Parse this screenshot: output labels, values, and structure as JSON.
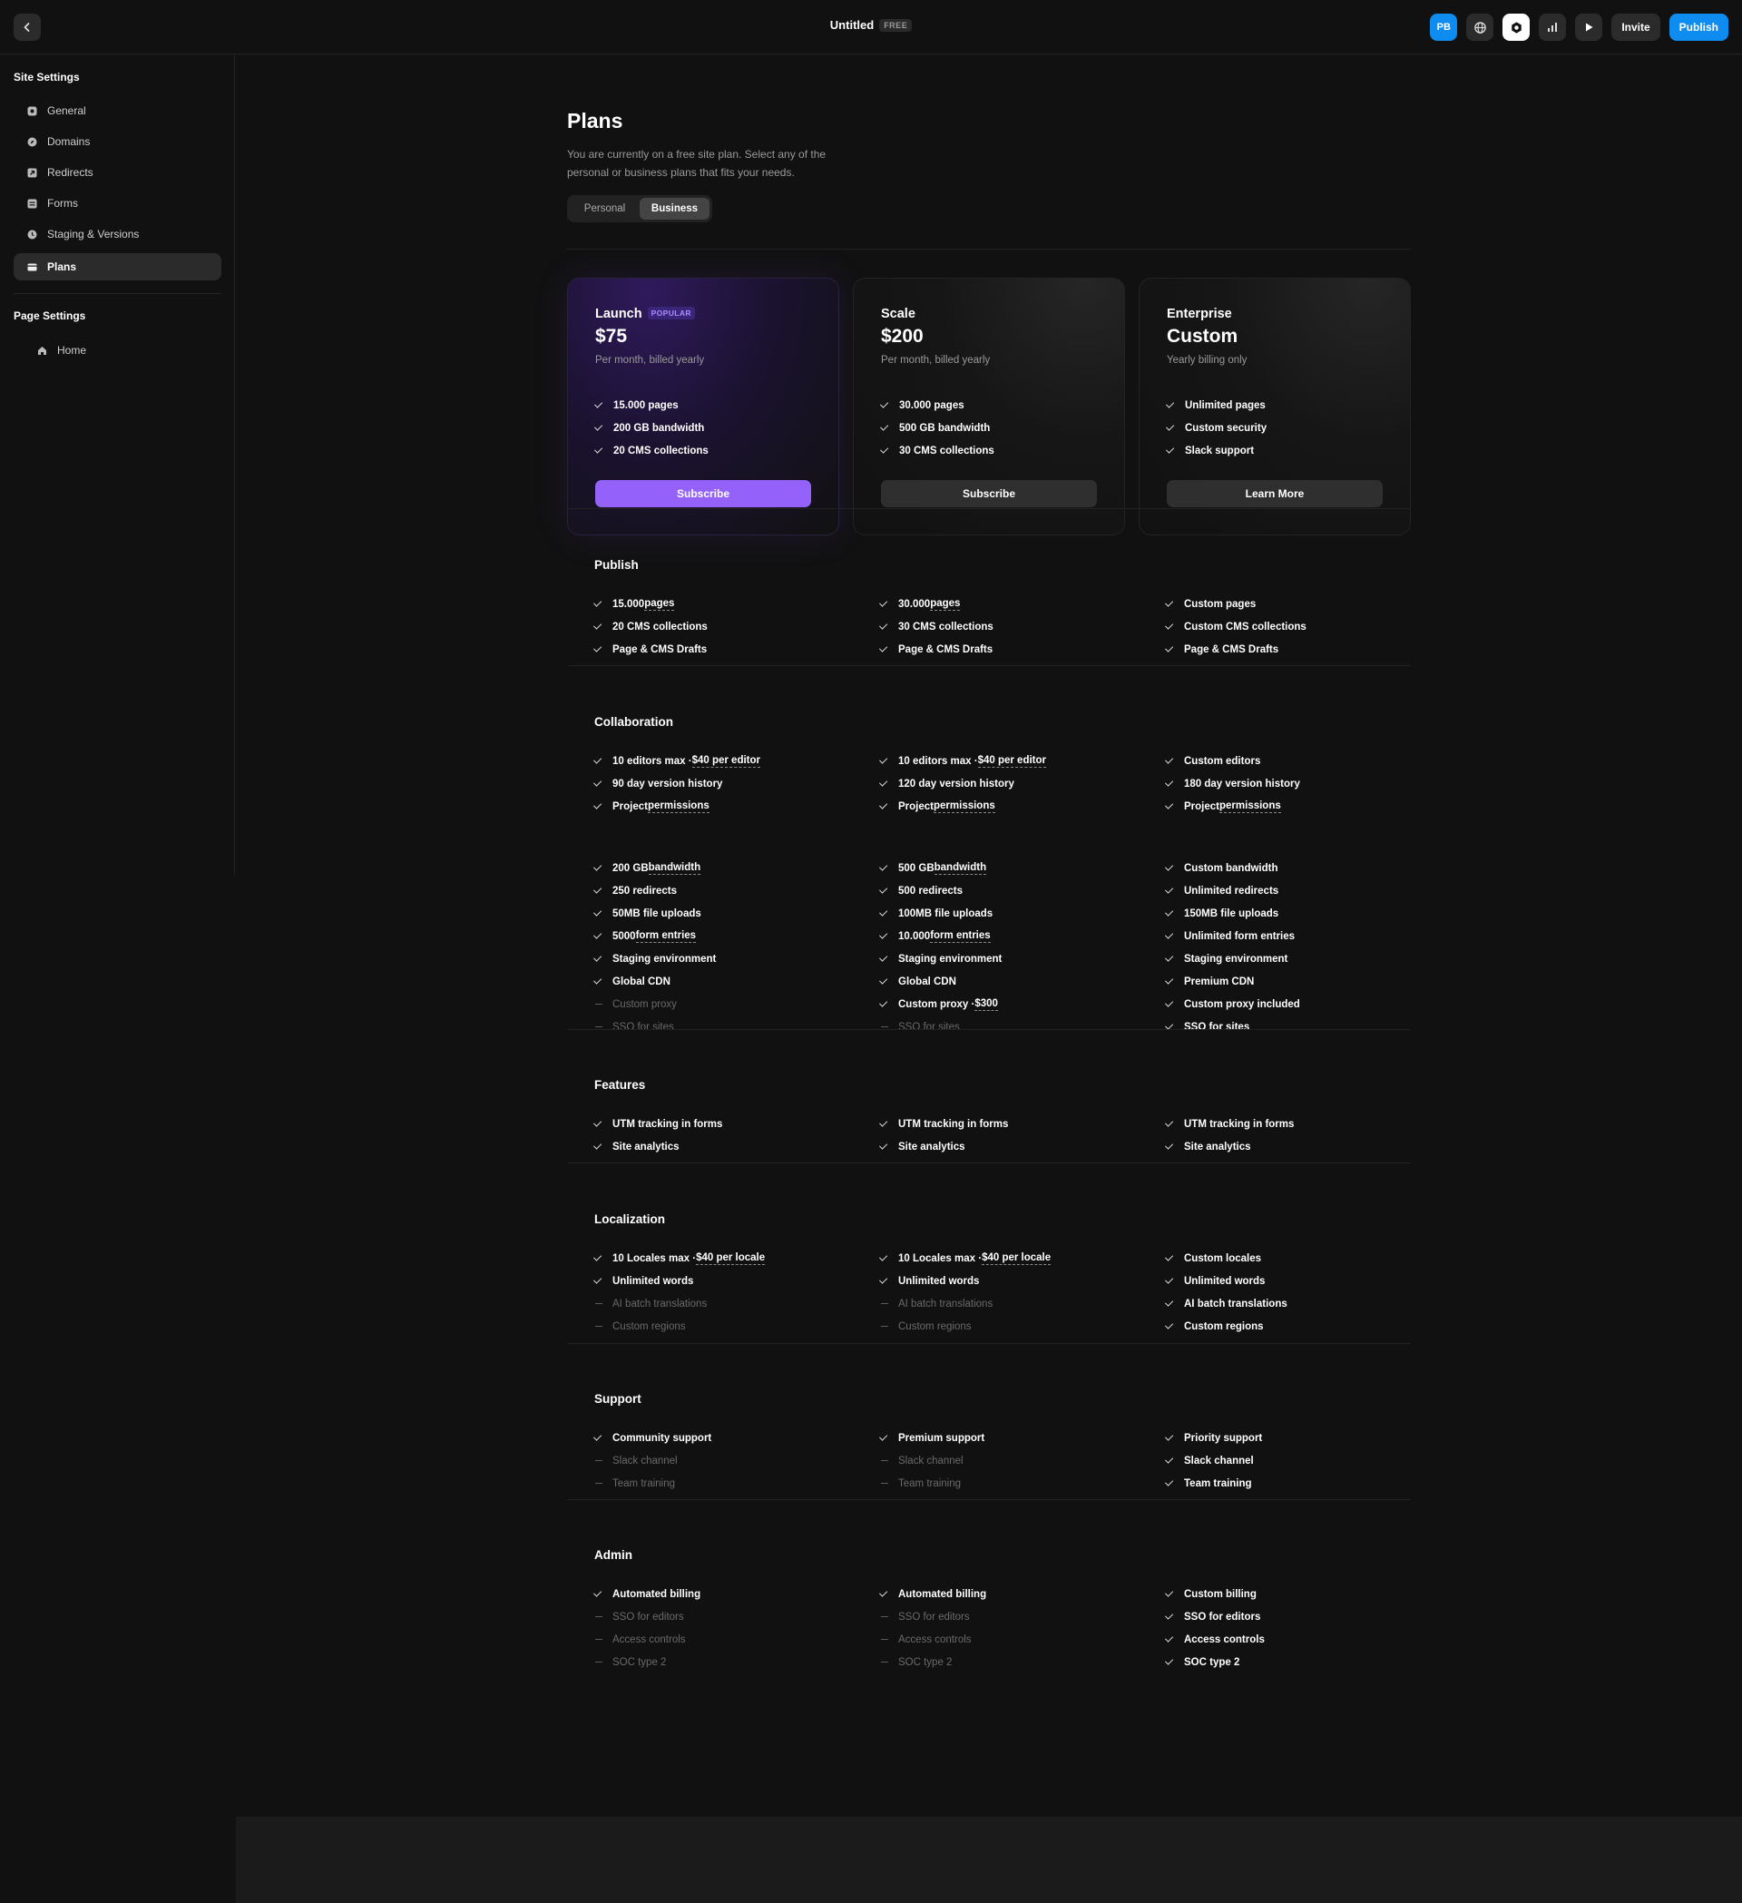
{
  "topbar": {
    "title": "Untitled",
    "badge": "FREE",
    "avatar": "PB",
    "invite": "Invite",
    "publish": "Publish"
  },
  "sidebar": {
    "site_heading": "Site Settings",
    "site_items": [
      "General",
      "Domains",
      "Redirects",
      "Forms",
      "Staging & Versions",
      "Plans"
    ],
    "page_heading": "Page Settings",
    "page_items": [
      "Home"
    ]
  },
  "plans": {
    "title": "Plans",
    "description": "You are currently on a free site plan. Select any of the personal or business plans that fits your needs.",
    "toggle": [
      "Personal",
      "Business"
    ],
    "cards": [
      {
        "name": "Launch",
        "badge": "POPULAR",
        "price": "$75",
        "billing": "Per month, billed yearly",
        "features": [
          "15.000 pages",
          "200 GB bandwidth",
          "20 CMS collections"
        ],
        "cta": "Subscribe"
      },
      {
        "name": "Scale",
        "price": "$200",
        "billing": "Per month, billed yearly",
        "features": [
          "30.000 pages",
          "500 GB bandwidth",
          "30 CMS collections"
        ],
        "cta": "Subscribe"
      },
      {
        "name": "Enterprise",
        "price": "Custom",
        "billing": "Yearly billing only",
        "features": [
          "Unlimited pages",
          "Custom security",
          "Slack support"
        ],
        "cta": "Learn More"
      }
    ]
  },
  "sections": [
    {
      "title": "Publish",
      "columns": [
        [
          {
            "t": "15.000 ",
            "u": "pages",
            "on": true
          },
          {
            "t": "20 CMS collections",
            "on": true
          },
          {
            "t": "Page & CMS Drafts",
            "on": true
          }
        ],
        [
          {
            "t": "30.000 ",
            "u": "pages",
            "on": true
          },
          {
            "t": "30 CMS collections",
            "on": true
          },
          {
            "t": "Page & CMS Drafts",
            "on": true
          }
        ],
        [
          {
            "t": "Custom pages",
            "on": true
          },
          {
            "t": "Custom CMS collections",
            "on": true
          },
          {
            "t": "Page & CMS Drafts",
            "on": true
          }
        ]
      ]
    },
    {
      "title": "Collaboration",
      "columns": [
        [
          {
            "t": "10 editors max · ",
            "u": "$40 per editor",
            "on": true
          },
          {
            "t": "90 day version history",
            "on": true
          },
          {
            "t": "Project ",
            "u": "permissions",
            "on": true
          }
        ],
        [
          {
            "t": "10 editors max · ",
            "u": "$40 per editor",
            "on": true
          },
          {
            "t": "120 day version history",
            "on": true
          },
          {
            "t": "Project ",
            "u": "permissions",
            "on": true
          }
        ],
        [
          {
            "t": "Custom editors",
            "on": true
          },
          {
            "t": "180 day version history",
            "on": true
          },
          {
            "t": "Project ",
            "u": "permissions",
            "on": true
          }
        ]
      ]
    },
    {
      "title": "",
      "columns": [
        [
          {
            "t": "200 GB ",
            "u": "bandwidth",
            "on": true
          },
          {
            "t": "250 redirects",
            "on": true
          },
          {
            "t": "50MB file uploads",
            "on": true
          },
          {
            "t": "5000 ",
            "u": "form entries",
            "on": true
          },
          {
            "t": "Staging environment",
            "on": true
          },
          {
            "t": "Global CDN",
            "on": true
          },
          {
            "t": "Custom proxy",
            "on": false
          },
          {
            "t": "SSO for sites",
            "on": false
          }
        ],
        [
          {
            "t": "500 GB ",
            "u": "bandwidth",
            "on": true
          },
          {
            "t": "500 redirects",
            "on": true
          },
          {
            "t": "100MB file uploads",
            "on": true
          },
          {
            "t": "10.000 ",
            "u": "form entries",
            "on": true
          },
          {
            "t": "Staging environment",
            "on": true
          },
          {
            "t": "Global CDN",
            "on": true
          },
          {
            "t": "Custom proxy · ",
            "u": "$300",
            "on": true
          },
          {
            "t": "SSO for sites",
            "on": false
          }
        ],
        [
          {
            "t": "Custom bandwidth",
            "on": true
          },
          {
            "t": "Unlimited redirects",
            "on": true
          },
          {
            "t": "150MB file uploads",
            "on": true
          },
          {
            "t": "Unlimited form entries",
            "on": true
          },
          {
            "t": "Staging environment",
            "on": true
          },
          {
            "t": "Premium CDN",
            "on": true
          },
          {
            "t": "Custom proxy included",
            "on": true
          },
          {
            "t": "SSO for sites",
            "on": true
          }
        ]
      ]
    },
    {
      "title": "Features",
      "columns": [
        [
          {
            "t": "UTM tracking in forms",
            "on": true
          },
          {
            "t": "Site analytics",
            "on": true
          }
        ],
        [
          {
            "t": "UTM tracking in forms",
            "on": true
          },
          {
            "t": "Site analytics",
            "on": true
          }
        ],
        [
          {
            "t": "UTM tracking in forms",
            "on": true
          },
          {
            "t": "Site analytics",
            "on": true
          }
        ]
      ]
    },
    {
      "title": "Localization",
      "columns": [
        [
          {
            "t": "10 Locales max · ",
            "u": "$40 per locale",
            "on": true
          },
          {
            "t": "Unlimited words",
            "on": true
          },
          {
            "t": "AI batch translations",
            "on": false
          },
          {
            "t": "Custom regions",
            "on": false
          }
        ],
        [
          {
            "t": "10 Locales max · ",
            "u": "$40 per locale",
            "on": true
          },
          {
            "t": "Unlimited words",
            "on": true
          },
          {
            "t": "AI batch translations",
            "on": false
          },
          {
            "t": "Custom regions",
            "on": false
          }
        ],
        [
          {
            "t": "Custom locales",
            "on": true
          },
          {
            "t": "Unlimited words",
            "on": true
          },
          {
            "t": "AI batch translations",
            "on": true
          },
          {
            "t": "Custom regions",
            "on": true
          }
        ]
      ]
    },
    {
      "title": "Support",
      "columns": [
        [
          {
            "t": "Community support",
            "on": true
          },
          {
            "t": "Slack channel",
            "on": false
          },
          {
            "t": "Team training",
            "on": false
          }
        ],
        [
          {
            "t": "Premium support",
            "on": true
          },
          {
            "t": "Slack channel",
            "on": false
          },
          {
            "t": "Team training",
            "on": false
          }
        ],
        [
          {
            "t": "Priority support",
            "on": true
          },
          {
            "t": "Slack channel",
            "on": true
          },
          {
            "t": "Team training",
            "on": true
          }
        ]
      ]
    },
    {
      "title": "Admin",
      "columns": [
        [
          {
            "t": "Automated billing",
            "on": true
          },
          {
            "t": "SSO for editors",
            "on": false
          },
          {
            "t": "Access controls",
            "on": false
          },
          {
            "t": "SOC type 2",
            "on": false
          }
        ],
        [
          {
            "t": "Automated billing",
            "on": true
          },
          {
            "t": "SSO for editors",
            "on": false
          },
          {
            "t": "Access controls",
            "on": false
          },
          {
            "t": "SOC type 2",
            "on": false
          }
        ],
        [
          {
            "t": "Custom billing",
            "on": true
          },
          {
            "t": "SSO for editors",
            "on": true
          },
          {
            "t": "Access controls",
            "on": true
          },
          {
            "t": "SOC type 2",
            "on": true
          }
        ]
      ]
    }
  ]
}
